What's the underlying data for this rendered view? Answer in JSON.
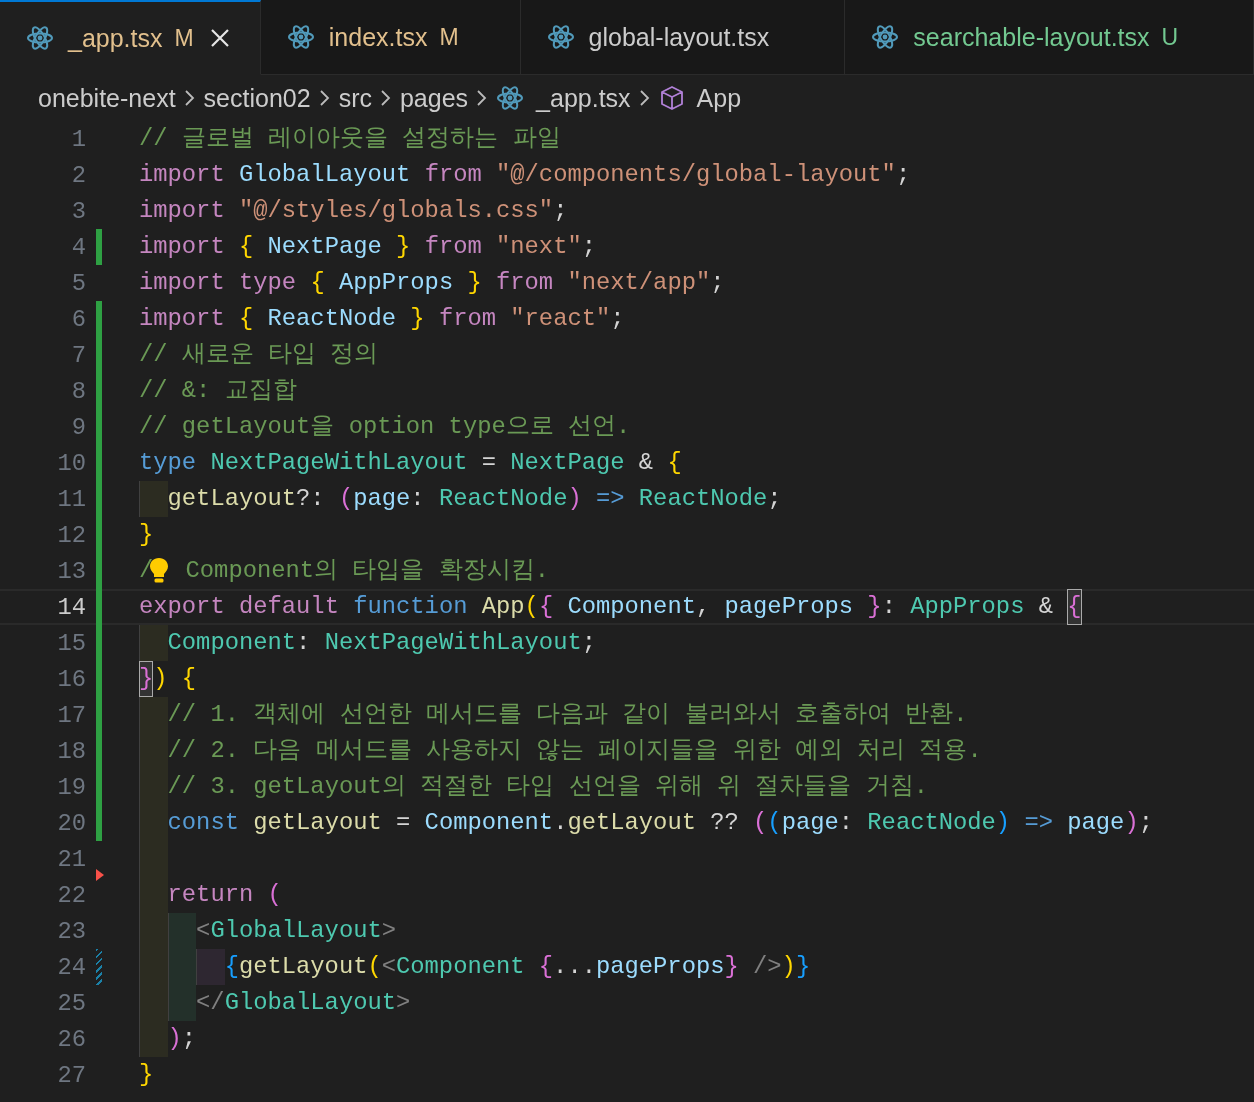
{
  "tabs": [
    {
      "label": "_app.tsx",
      "status": "M",
      "kind": "modified",
      "selected": true
    },
    {
      "label": "index.tsx",
      "status": "M",
      "kind": "modified",
      "selected": false
    },
    {
      "label": "global-layout.tsx",
      "kind": "plain",
      "selected": false
    },
    {
      "label": "searchable-layout.tsx",
      "status": "U",
      "kind": "untracked",
      "selected": false
    }
  ],
  "breadcrumbs": [
    {
      "label": "onebite-next",
      "kind": "folder"
    },
    {
      "label": "section02",
      "kind": "folder"
    },
    {
      "label": "src",
      "kind": "folder"
    },
    {
      "label": "pages",
      "kind": "folder"
    },
    {
      "label": "_app.tsx",
      "kind": "file"
    },
    {
      "label": "App",
      "kind": "symbol"
    }
  ],
  "lines": [
    {
      "number": "1",
      "kind": "unchanged",
      "current": false,
      "tokens": [
        {
          "t": "// 글로벌 레이아웃을 설정하는 파일",
          "kind": "comment"
        }
      ]
    },
    {
      "number": "2",
      "kind": "unchanged",
      "current": false,
      "tokens": [
        {
          "t": "import ",
          "kind": "keyword"
        },
        {
          "t": "GlobalLayout ",
          "kind": "variable"
        },
        {
          "t": "from ",
          "kind": "keyword"
        },
        {
          "t": "\"@/components/global-layout\"",
          "kind": "string"
        },
        {
          "t": ";",
          "kind": "punctuation"
        }
      ]
    },
    {
      "number": "3",
      "kind": "unchanged",
      "current": false,
      "tokens": [
        {
          "t": "import ",
          "kind": "keyword"
        },
        {
          "t": "\"@/styles/globals.css\"",
          "kind": "string"
        },
        {
          "t": ";",
          "kind": "punctuation"
        }
      ]
    },
    {
      "number": "4",
      "kind": "added",
      "current": false,
      "tokens": [
        {
          "t": "import ",
          "kind": "keyword"
        },
        {
          "t": "{ ",
          "kind": "bracket1"
        },
        {
          "t": "NextPage ",
          "kind": "variable"
        },
        {
          "t": "} ",
          "kind": "bracket1"
        },
        {
          "t": "from ",
          "kind": "keyword"
        },
        {
          "t": "\"next\"",
          "kind": "string"
        },
        {
          "t": ";",
          "kind": "punctuation"
        }
      ]
    },
    {
      "number": "5",
      "kind": "unchanged",
      "current": false,
      "tokens": [
        {
          "t": "import ",
          "kind": "keyword"
        },
        {
          "t": "type ",
          "kind": "keyword"
        },
        {
          "t": "{ ",
          "kind": "bracket1"
        },
        {
          "t": "AppProps ",
          "kind": "variable"
        },
        {
          "t": "} ",
          "kind": "bracket1"
        },
        {
          "t": "from ",
          "kind": "keyword"
        },
        {
          "t": "\"next/app\"",
          "kind": "string"
        },
        {
          "t": ";",
          "kind": "punctuation"
        }
      ]
    },
    {
      "number": "6",
      "kind": "added",
      "current": false,
      "tokens": [
        {
          "t": "import ",
          "kind": "keyword"
        },
        {
          "t": "{ ",
          "kind": "bracket1"
        },
        {
          "t": "ReactNode ",
          "kind": "variable"
        },
        {
          "t": "} ",
          "kind": "bracket1"
        },
        {
          "t": "from ",
          "kind": "keyword"
        },
        {
          "t": "\"react\"",
          "kind": "string"
        },
        {
          "t": ";",
          "kind": "punctuation"
        }
      ]
    },
    {
      "number": "7",
      "kind": "added",
      "current": false,
      "tokens": [
        {
          "t": "// 새로운 타입 정의",
          "kind": "comment"
        }
      ]
    },
    {
      "number": "8",
      "kind": "added",
      "current": false,
      "tokens": [
        {
          "t": "// &: 교집합",
          "kind": "comment"
        }
      ]
    },
    {
      "number": "9",
      "kind": "added",
      "current": false,
      "tokens": [
        {
          "t": "// getLayout을 option type으로 선언.",
          "kind": "comment"
        }
      ]
    },
    {
      "number": "10",
      "kind": "added",
      "current": false,
      "tokens": [
        {
          "t": "type ",
          "kind": "storage"
        },
        {
          "t": "NextPageWithLayout ",
          "kind": "type"
        },
        {
          "t": "= ",
          "kind": "punctuation"
        },
        {
          "t": "NextPage ",
          "kind": "type"
        },
        {
          "t": "& ",
          "kind": "punctuation"
        },
        {
          "t": "{",
          "kind": "bracket1"
        }
      ]
    },
    {
      "number": "11",
      "kind": "added",
      "current": false,
      "tokens": [
        {
          "kind": "indent"
        },
        {
          "t": "getLayout",
          "kind": "function"
        },
        {
          "t": "?: ",
          "kind": "punctuation"
        },
        {
          "t": "(",
          "kind": "bracket2"
        },
        {
          "t": "page",
          "kind": "variable"
        },
        {
          "t": ": ",
          "kind": "punctuation"
        },
        {
          "t": "ReactNode",
          "kind": "type"
        },
        {
          "t": ") ",
          "kind": "bracket2"
        },
        {
          "t": "=> ",
          "kind": "storage"
        },
        {
          "t": "ReactNode",
          "kind": "type"
        },
        {
          "t": ";",
          "kind": "punctuation"
        }
      ]
    },
    {
      "number": "12",
      "kind": "added",
      "current": false,
      "tokens": [
        {
          "t": "}",
          "kind": "bracket1"
        }
      ]
    },
    {
      "number": "13",
      "kind": "added",
      "current": false,
      "lightbulb": true,
      "tokens": [
        {
          "t": "/",
          "kind": "comment"
        },
        {
          "t": " Component의 타입을 확장시킴.",
          "kind": "comment"
        }
      ]
    },
    {
      "number": "14",
      "kind": "added",
      "current": true,
      "tokens": [
        {
          "t": "export ",
          "kind": "keyword"
        },
        {
          "t": "default ",
          "kind": "keyword"
        },
        {
          "t": "function ",
          "kind": "storage"
        },
        {
          "t": "App",
          "kind": "function"
        },
        {
          "t": "(",
          "kind": "bracket1"
        },
        {
          "t": "{ ",
          "kind": "bracket2"
        },
        {
          "t": "Component",
          "kind": "variable"
        },
        {
          "t": ", ",
          "kind": "punctuation"
        },
        {
          "t": "pageProps ",
          "kind": "variable"
        },
        {
          "t": "}",
          "kind": "bracket2"
        },
        {
          "t": ": ",
          "kind": "punctuation"
        },
        {
          "t": "AppProps ",
          "kind": "type"
        },
        {
          "t": "& ",
          "kind": "punctuation"
        },
        {
          "t": "{",
          "kind": "bracket2",
          "matched": true
        }
      ]
    },
    {
      "number": "15",
      "kind": "added",
      "current": false,
      "tokens": [
        {
          "kind": "indent"
        },
        {
          "t": "Component",
          "kind": "type"
        },
        {
          "t": ": ",
          "kind": "punctuation"
        },
        {
          "t": "NextPageWithLayout",
          "kind": "type"
        },
        {
          "t": ";",
          "kind": "punctuation"
        }
      ]
    },
    {
      "number": "16",
      "kind": "added",
      "current": false,
      "tokens": [
        {
          "t": "}",
          "kind": "bracket2",
          "matched": true
        },
        {
          "t": ")",
          "kind": "bracket1"
        },
        {
          "t": " {",
          "kind": "bracket1"
        }
      ]
    },
    {
      "number": "17",
      "kind": "added",
      "current": false,
      "tokens": [
        {
          "kind": "indent"
        },
        {
          "t": "// 1. 객체에 선언한 메서드를 다음과 같이 불러와서 호출하여 반환.",
          "kind": "comment"
        }
      ]
    },
    {
      "number": "18",
      "kind": "added",
      "current": false,
      "tokens": [
        {
          "kind": "indent"
        },
        {
          "t": "// 2. 다음 메서드를 사용하지 않는 페이지들을 위한 예외 처리 적용.",
          "kind": "comment"
        }
      ]
    },
    {
      "number": "19",
      "kind": "added",
      "current": false,
      "tokens": [
        {
          "kind": "indent"
        },
        {
          "t": "// 3. getLayout의 적절한 타입 선언을 위해 위 절차들을 거침.",
          "kind": "comment"
        }
      ]
    },
    {
      "number": "20",
      "kind": "added",
      "current": false,
      "tokens": [
        {
          "kind": "indent"
        },
        {
          "t": "const ",
          "kind": "storage"
        },
        {
          "t": "getLayout ",
          "kind": "function"
        },
        {
          "t": "= ",
          "kind": "punctuation"
        },
        {
          "t": "Component",
          "kind": "variable"
        },
        {
          "t": ".",
          "kind": "punctuation"
        },
        {
          "t": "getLayout ",
          "kind": "function"
        },
        {
          "t": "?? ",
          "kind": "punctuation"
        },
        {
          "t": "(",
          "kind": "bracket2"
        },
        {
          "t": "(",
          "kind": "bracket3"
        },
        {
          "t": "page",
          "kind": "variable"
        },
        {
          "t": ": ",
          "kind": "punctuation"
        },
        {
          "t": "ReactNode",
          "kind": "type"
        },
        {
          "t": ") ",
          "kind": "bracket3"
        },
        {
          "t": "=> ",
          "kind": "storage"
        },
        {
          "t": "page",
          "kind": "variable"
        },
        {
          "t": ")",
          "kind": "bracket2"
        },
        {
          "t": ";",
          "kind": "punctuation"
        }
      ]
    },
    {
      "number": "21",
      "kind": "unchanged",
      "current": false,
      "tokens": [
        {
          "kind": "indent"
        }
      ]
    },
    {
      "number": "22",
      "kind": "deleted",
      "current": false,
      "tokens": [
        {
          "kind": "indent"
        },
        {
          "t": "return ",
          "kind": "keyword"
        },
        {
          "t": "(",
          "kind": "bracket2"
        }
      ]
    },
    {
      "number": "23",
      "kind": "unchanged",
      "current": false,
      "tokens": [
        {
          "kind": "indent"
        },
        {
          "kind": "indent"
        },
        {
          "t": "<",
          "kind": "tag"
        },
        {
          "t": "GlobalLayout",
          "kind": "type"
        },
        {
          "t": ">",
          "kind": "tag"
        }
      ]
    },
    {
      "number": "24",
      "kind": "modified",
      "current": false,
      "tokens": [
        {
          "kind": "indent"
        },
        {
          "kind": "indent"
        },
        {
          "kind": "indent"
        },
        {
          "t": "{",
          "kind": "bracket3"
        },
        {
          "t": "getLayout",
          "kind": "function"
        },
        {
          "t": "(",
          "kind": "bracket1"
        },
        {
          "t": "<",
          "kind": "tag"
        },
        {
          "t": "Component ",
          "kind": "type"
        },
        {
          "t": "{",
          "kind": "bracket2"
        },
        {
          "t": "...",
          "kind": "punctuation"
        },
        {
          "t": "pageProps",
          "kind": "variable"
        },
        {
          "t": "} ",
          "kind": "bracket2"
        },
        {
          "t": "/>",
          "kind": "tag"
        },
        {
          "t": ")",
          "kind": "bracket1"
        },
        {
          "t": "}",
          "kind": "bracket3"
        }
      ]
    },
    {
      "number": "25",
      "kind": "unchanged",
      "current": false,
      "tokens": [
        {
          "kind": "indent"
        },
        {
          "kind": "indent"
        },
        {
          "t": "</",
          "kind": "tag"
        },
        {
          "t": "GlobalLayout",
          "kind": "type"
        },
        {
          "t": ">",
          "kind": "tag"
        }
      ]
    },
    {
      "number": "26",
      "kind": "unchanged",
      "current": false,
      "tokens": [
        {
          "kind": "indent"
        },
        {
          "t": ")",
          "kind": "bracket2"
        },
        {
          "t": ";",
          "kind": "punctuation"
        }
      ]
    },
    {
      "number": "27",
      "kind": "unchanged",
      "current": false,
      "tokens": [
        {
          "t": "}",
          "kind": "bracket1"
        }
      ]
    }
  ]
}
